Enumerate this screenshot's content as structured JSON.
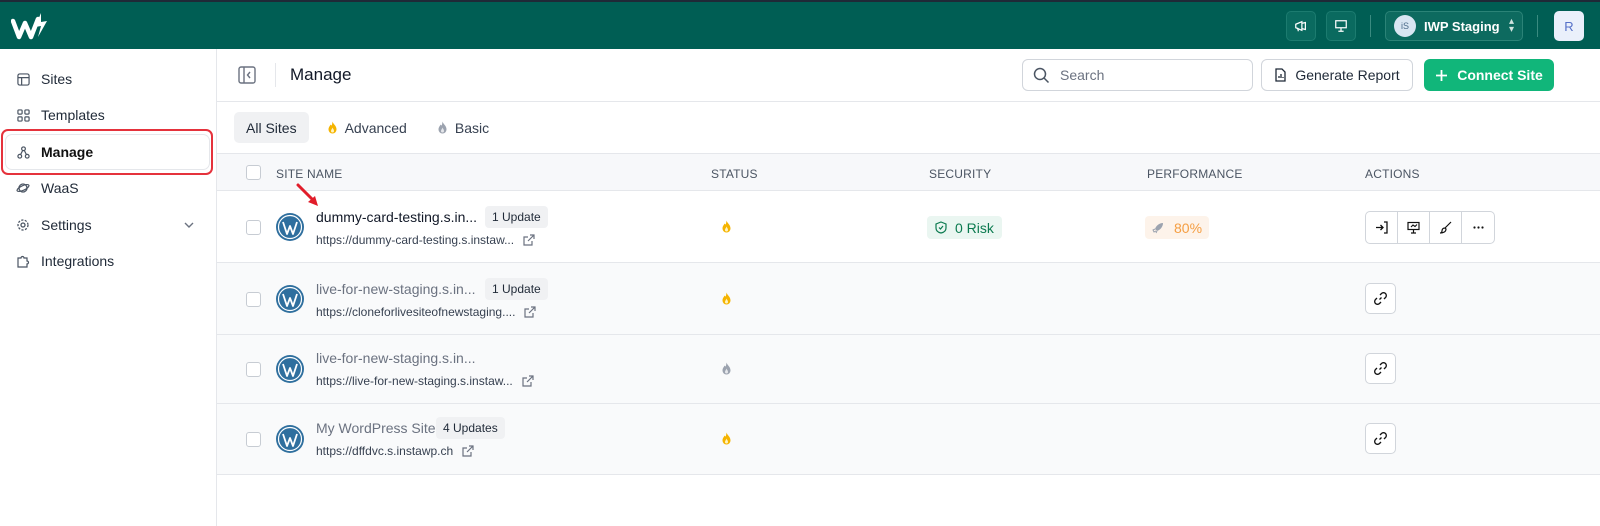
{
  "app": {
    "brand_color": "#005e54",
    "accent": "#11b67a",
    "logo": "instawp-logo"
  },
  "topbar": {
    "workspace": {
      "initials": "iS",
      "name": "IWP Staging"
    },
    "user_initial": "R",
    "icons": [
      "megaphone-icon",
      "presentation-icon"
    ]
  },
  "sidebar": {
    "items": [
      {
        "label": "Sites",
        "icon": "layout-icon"
      },
      {
        "label": "Templates",
        "icon": "grid-icon"
      },
      {
        "label": "Manage",
        "icon": "hierarchy-icon",
        "active": true
      },
      {
        "label": "WaaS",
        "icon": "planet-icon"
      },
      {
        "label": "Settings",
        "icon": "gear-icon",
        "expandable": true
      },
      {
        "label": "Integrations",
        "icon": "puzzle-icon"
      }
    ]
  },
  "header": {
    "title": "Manage",
    "search_placeholder": "Search",
    "generate_report": "Generate Report",
    "connect_site": "Connect Site"
  },
  "tabs": [
    {
      "label": "All Sites",
      "active": true
    },
    {
      "label": "Advanced",
      "icon": "flame-icon"
    },
    {
      "label": "Basic",
      "icon": "flame-icon"
    }
  ],
  "table": {
    "columns": [
      "SITE NAME",
      "STATUS",
      "SECURITY",
      "PERFORMANCE",
      "ACTIONS"
    ],
    "rows": [
      {
        "name": "dummy-card-testing.s.in...",
        "badge": "1 Update",
        "url": "https://dummy-card-testing.s.instaw...",
        "security": "0 Risk",
        "performance": "80%"
      },
      {
        "name": "live-for-new-staging.s.in...",
        "badge": "1 Update",
        "url": "https://cloneforlivesiteofnewstaging...."
      },
      {
        "name": "live-for-new-staging.s.in...",
        "badge": "",
        "url": "https://live-for-new-staging.s.instaw..."
      },
      {
        "name": "My WordPress Site",
        "badge": "4 Updates",
        "url": "https://dffdvc.s.instawp.ch"
      }
    ]
  }
}
